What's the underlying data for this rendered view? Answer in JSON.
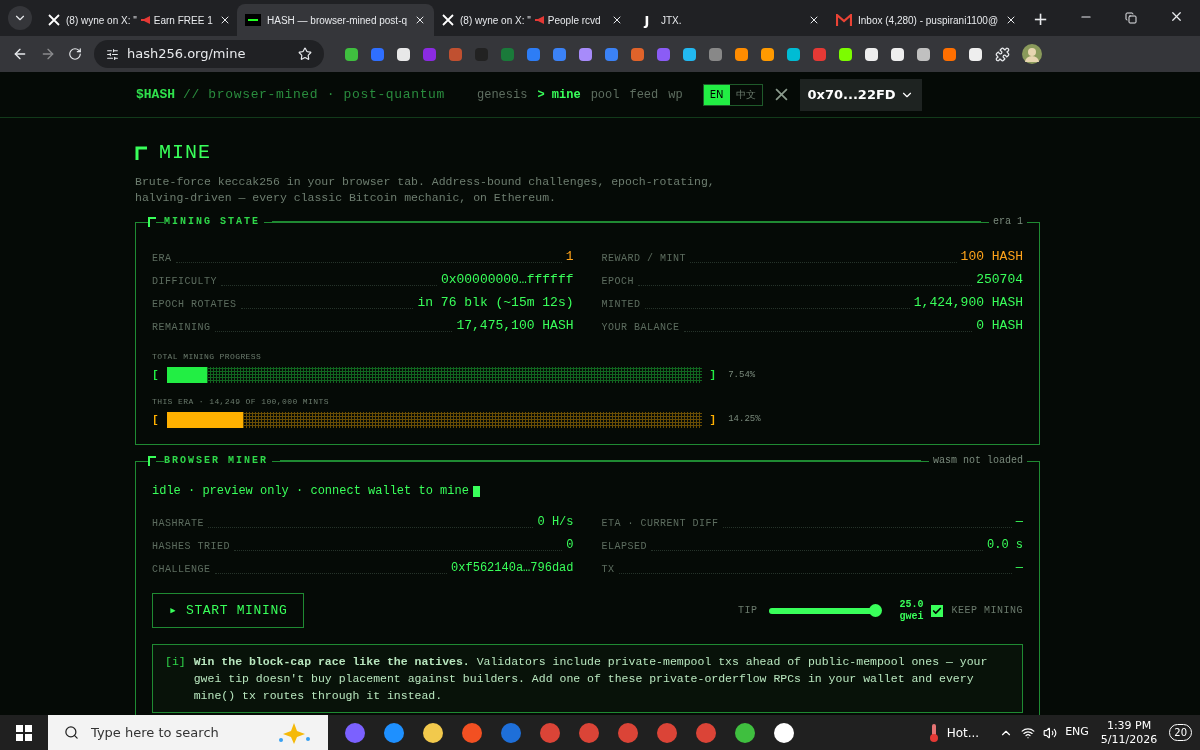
{
  "browser": {
    "tabs": [
      {
        "kind": "x",
        "title": "(8) wyne on X: \"",
        "title_rest": "Earn FREE 1",
        "selected": false
      },
      {
        "kind": "hash",
        "title": "HASH — browser-mined post-q",
        "selected": true
      },
      {
        "kind": "x",
        "title": "(8) wyne on X: \"",
        "title_rest": "People rcvd",
        "selected": false
      },
      {
        "kind": "letter",
        "favicon_text": "J",
        "title": "JTX.",
        "selected": false
      },
      {
        "kind": "mail",
        "title": "Inbox (4,280) - puspirani1100@",
        "selected": false
      }
    ],
    "new_tab": "+",
    "url": "hash256.org/mine"
  },
  "nav": {
    "brand": "$HASH",
    "tagline": "// browser-mined · post-quantum",
    "links": [
      {
        "label": "genesis",
        "selected": false
      },
      {
        "label": "> mine",
        "selected": true
      },
      {
        "label": "pool",
        "selected": false
      },
      {
        "label": "feed",
        "selected": false
      },
      {
        "label": "wp",
        "selected": false
      }
    ],
    "languages": [
      {
        "label": "EN",
        "selected": true
      },
      {
        "label": "中文",
        "selected": false
      }
    ],
    "wallet": "0x70...22FD"
  },
  "page": {
    "title": "MINE",
    "description": "Brute-force keccak256 in your browser tab. Address-bound challenges, epoch-rotating, halving-driven — every classic Bitcoin mechanic, on Ethereum."
  },
  "mining_state": {
    "title": "MINING STATE",
    "tag": "era 1",
    "stats": [
      {
        "label": "ERA",
        "value": "1",
        "color": "#ffa31a"
      },
      {
        "label": "REWARD / MINT",
        "value": "100 HASH",
        "color": "#ffa31a"
      },
      {
        "label": "DIFFICULTY",
        "value": "0x00000000…ffffff",
        "color": "#39ff5a"
      },
      {
        "label": "EPOCH",
        "value": "250704",
        "color": "#39ff5a"
      },
      {
        "label": "EPOCH ROTATES",
        "value": "in 76 blk (~15m 12s)",
        "color": "#39ff5a"
      },
      {
        "label": "MINTED",
        "value": "1,424,900 HASH",
        "color": "#39ff5a"
      },
      {
        "label": "REMAINING",
        "value": "17,475,100 HASH",
        "color": "#39ff5a"
      },
      {
        "label": "YOUR BALANCE",
        "value": "0 HASH",
        "color": "#39ff5a"
      }
    ],
    "progress": [
      {
        "label": "TOTAL MINING PROGRESS",
        "open": "[",
        "close": "]",
        "level": 0.0754,
        "reading": "7.54%",
        "color": "#22ee44"
      },
      {
        "label": "THIS ERA · 14,249 OF 100,000 MINTS",
        "open": "[",
        "close": "]",
        "level": 0.1425,
        "reading": "14.25%",
        "color": "#ffb000"
      }
    ]
  },
  "browser_miner": {
    "title": "BROWSER MINER",
    "tag": "wasm not loaded",
    "status": "idle · preview only · connect wallet to mine",
    "stats": [
      {
        "label": "HASHRATE",
        "value": "0 H/s"
      },
      {
        "label": "ETA · CURRENT DIFF",
        "value": "—"
      },
      {
        "label": "HASHES TRIED",
        "value": "0"
      },
      {
        "label": "ELAPSED",
        "value": "0.0 s"
      },
      {
        "label": "CHALLENGE",
        "value": "0xf562140a…796dad"
      },
      {
        "label": "TX",
        "value": "—"
      }
    ],
    "start_button": "▸ START MINING",
    "tip": {
      "label": "TIP",
      "level": 0.97,
      "value": "25.0",
      "unit": "gwei"
    },
    "keep_mining": {
      "label": "KEEP MINING",
      "checked": true
    },
    "notice": {
      "marker": "[i]",
      "text": "**Win the block-cap race like the natives.** Validators include private-mempool txs ahead of public-mempool ones — your gwei tip doesn't buy placement against builders. Add one of these private-orderflow RPCs in your wallet and every mine() tx routes through it instead."
    }
  },
  "taskbar": {
    "search_placeholder": "Type here to search",
    "weather": "Hot...",
    "language": "ENG",
    "time": "1:39 PM",
    "date": "5/11/2026",
    "notifications": "20"
  }
}
